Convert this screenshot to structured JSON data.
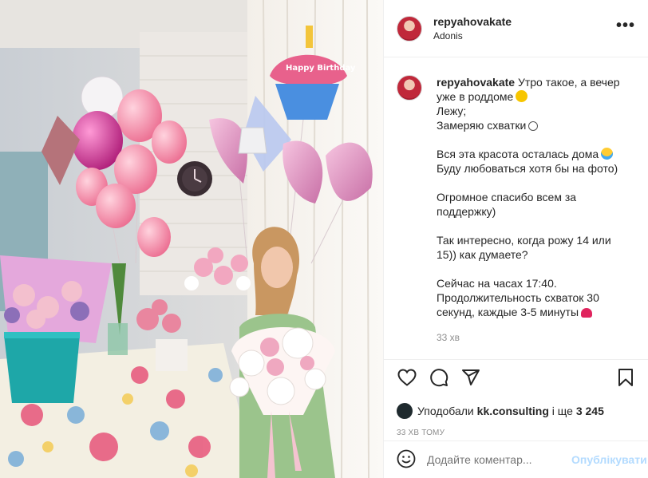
{
  "post": {
    "author": "repyahovakate",
    "location": "Adonis",
    "more_icon": "more-horizontal-icon",
    "photo_sign": {
      "balloon_text": "Happy Birthday"
    },
    "caption": {
      "author": "repyahovakate",
      "lines": [
        "Утро такое, а вечер",
        "уже в роддоме",
        "Лежу;",
        "Замеряю схватки",
        "",
        "Вся эта красота осталась дома",
        "Буду любоваться хотя бы на фото)",
        "",
        "Огромное спасибо всем за",
        "поддержку)",
        "",
        "Так интересно, когда рожу 14 или",
        "15)) как думаете?",
        "",
        "Сейчас на часах 17:40.",
        "Продолжительность схваток 30",
        "секунд, каждые 3-5 минуты"
      ],
      "time": "33 хв"
    },
    "actions": {
      "icons": [
        "heart-icon",
        "comment-icon",
        "share-icon",
        "bookmark-icon"
      ]
    },
    "likes": {
      "prefix": "Уподобали",
      "user": "kk.consulting",
      "middle": "і ще",
      "count": "3 245"
    },
    "posted_ago": "33 ХВ ТОМУ",
    "comment_box": {
      "placeholder": "Додайте коментар...",
      "post_label": "Опублікувати",
      "emoji_icon": "smiley-icon"
    },
    "colors": {
      "link_disabled": "#b3dbff",
      "muted": "#8e8e8e",
      "text": "#262626",
      "border": "#efefef"
    }
  }
}
